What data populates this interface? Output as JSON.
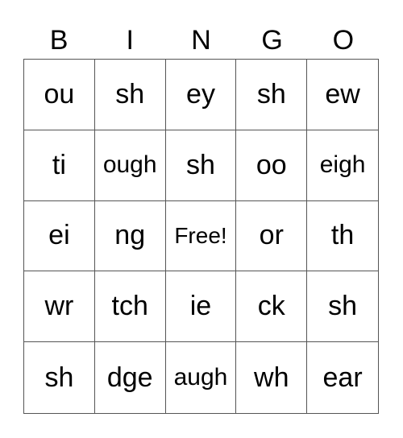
{
  "header": [
    "B",
    "I",
    "N",
    "G",
    "O"
  ],
  "cells": [
    "ou",
    "sh",
    "ey",
    "sh",
    "ew",
    "ti",
    "ough",
    "sh",
    "oo",
    "eigh",
    "ei",
    "ng",
    "Free!",
    "or",
    "th",
    "wr",
    "tch",
    "ie",
    "ck",
    "sh",
    "sh",
    "dge",
    "augh",
    "wh",
    "ear"
  ]
}
